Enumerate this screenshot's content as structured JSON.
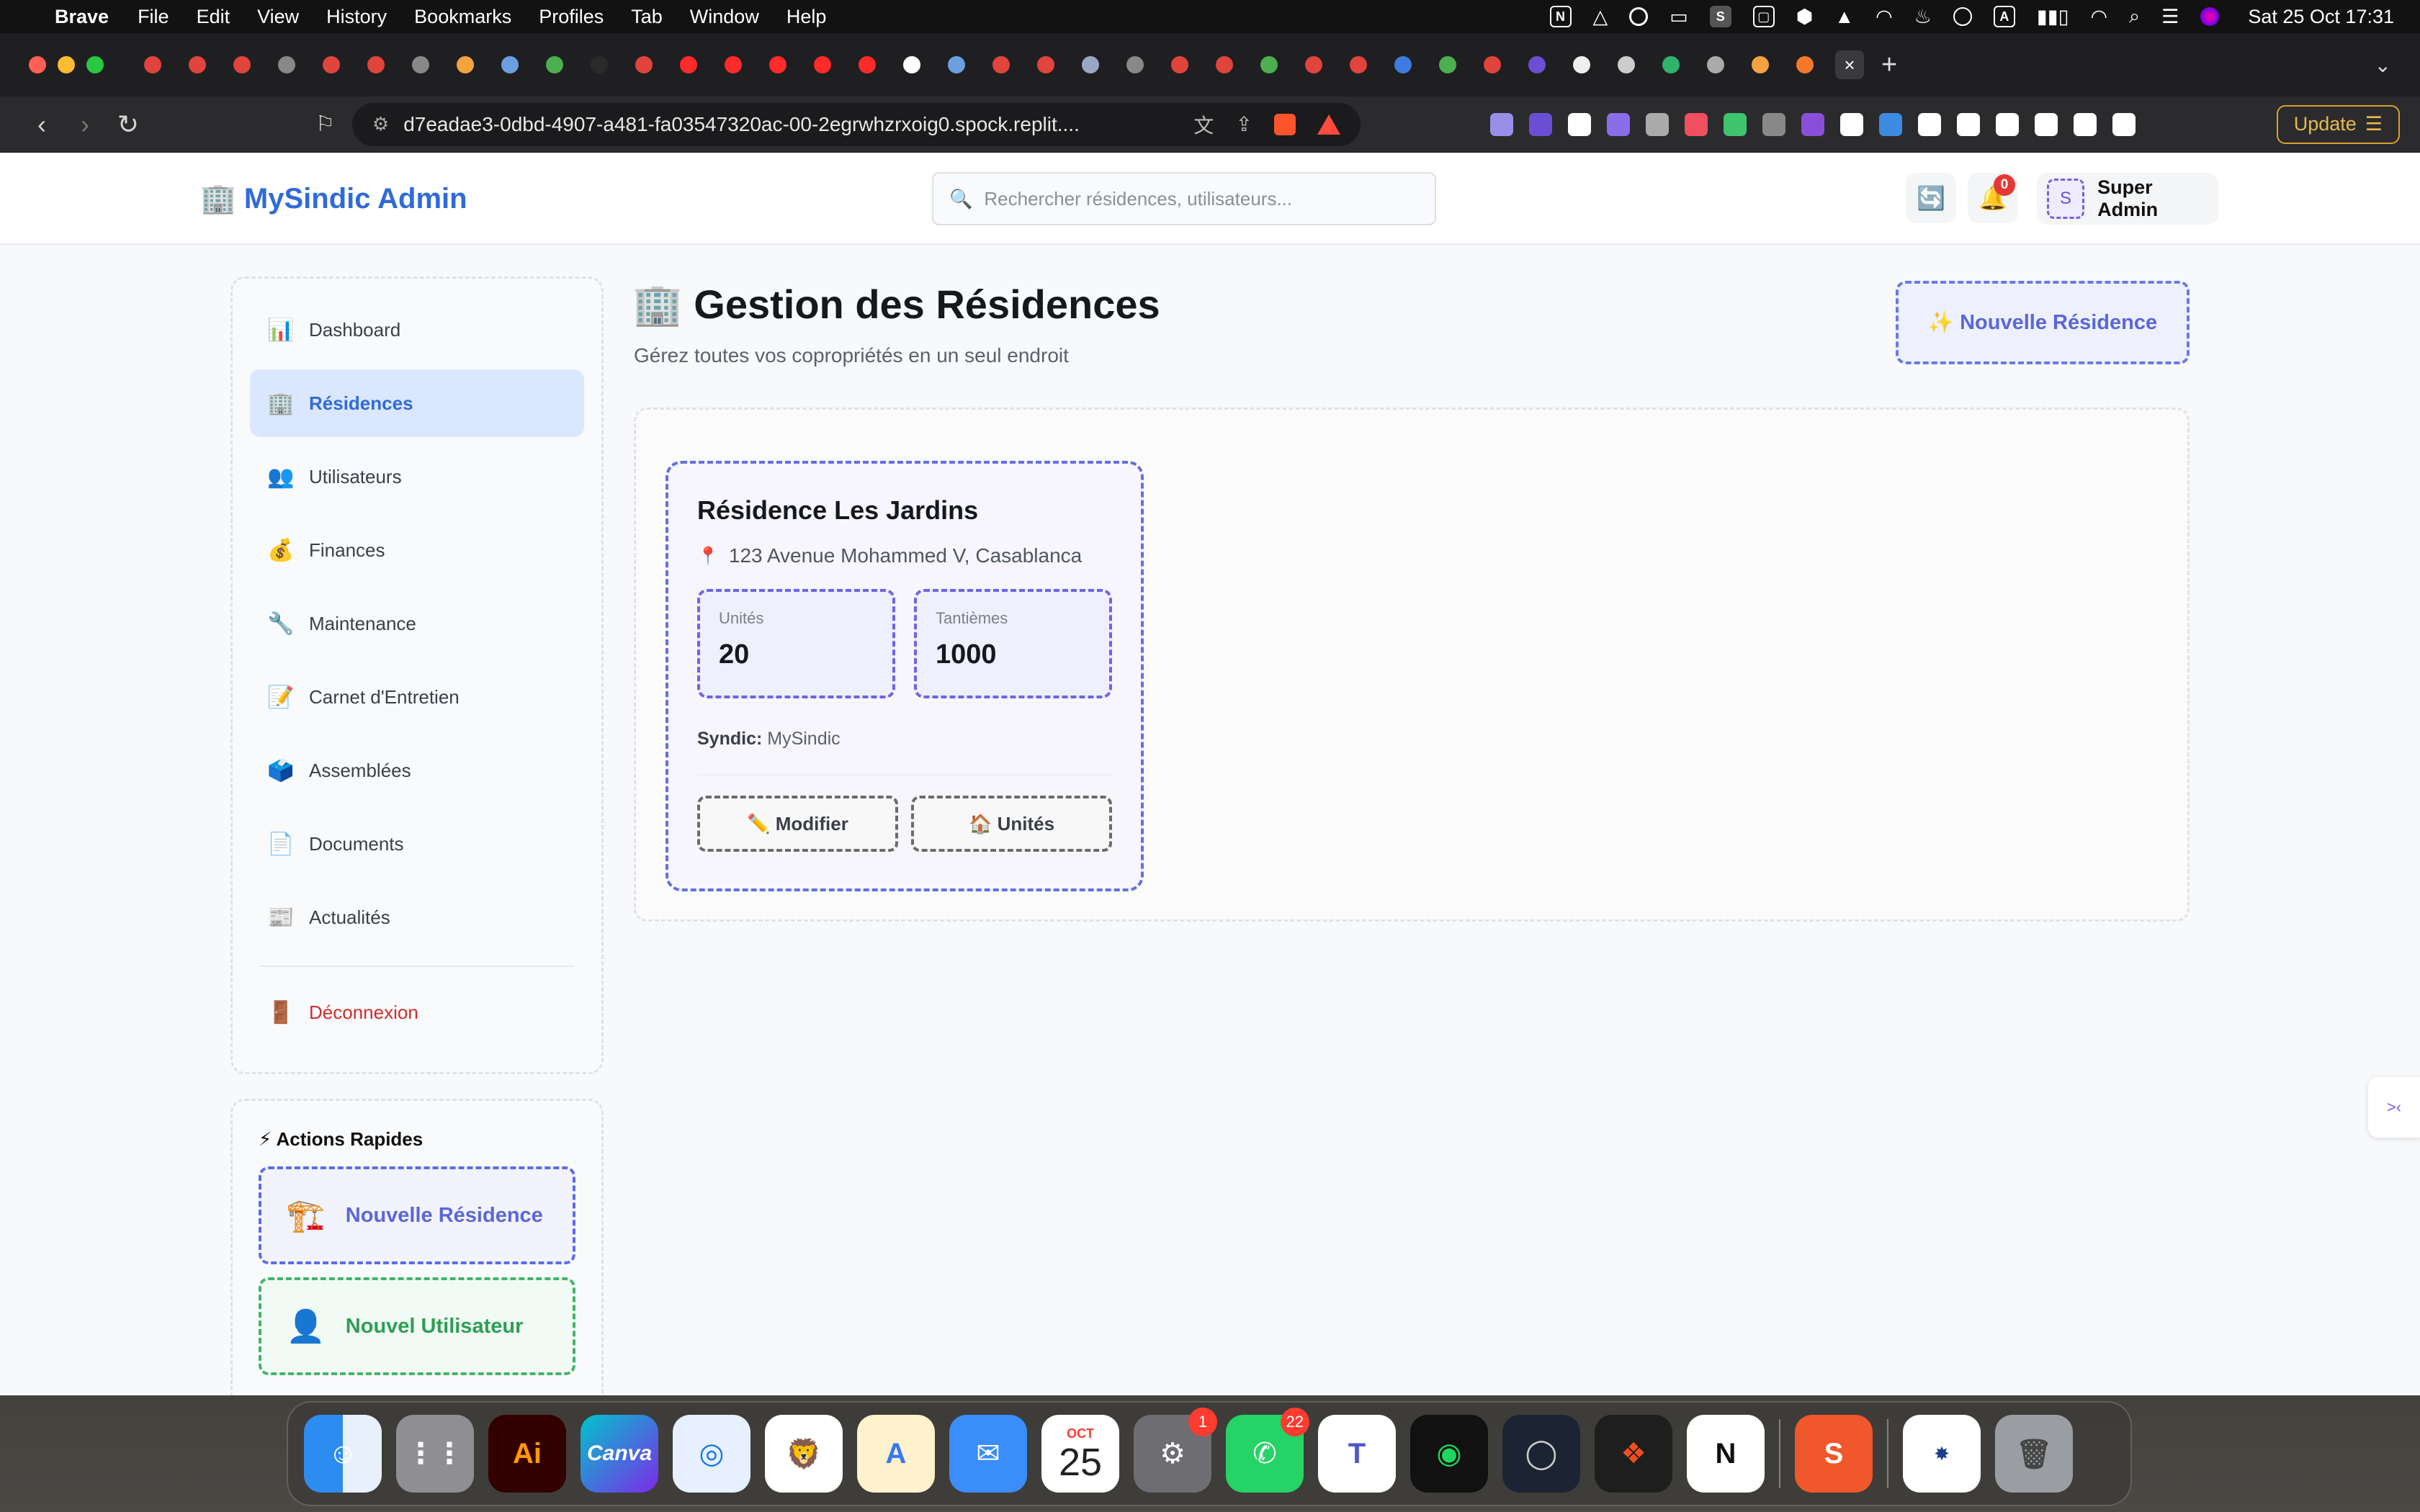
{
  "menubar": {
    "app": "Brave",
    "items": [
      "File",
      "Edit",
      "View",
      "History",
      "Bookmarks",
      "Profiles",
      "Tab",
      "Window",
      "Help"
    ],
    "status_a_icon": "A",
    "clock": "Sat 25 Oct  17:31"
  },
  "browser": {
    "url": "d7eadae3-0dbd-4907-a481-fa03547320ac-00-2egrwhzrxoig0.spock.replit....",
    "update_label": "Update",
    "tab_colors": [
      "#e0443c",
      "#e0443c",
      "#e0443c",
      "#888",
      "#e0443c",
      "#e0443c",
      "#888",
      "#f4a340",
      "#6aa0e0",
      "#4caf50",
      "#2a2a2a",
      "#e0443c",
      "#ff2a2a",
      "#ff2a2a",
      "#ff2a2a",
      "#ff2a2a",
      "#ff2a2a",
      "#ffffff",
      "#6aa0e0",
      "#e0443c",
      "#e0443c",
      "#9aa7c4",
      "#888",
      "#e0443c",
      "#e0443c",
      "#4caf50",
      "#e0443c",
      "#e0443c",
      "#3d7be0",
      "#4caf50",
      "#e0443c",
      "#6a4fd4",
      "#f0f0f0",
      "#cccccc",
      "#2fb36a",
      "#aaaaaa",
      "#f4a340",
      "#f4782b"
    ],
    "ext_colors": [
      "#9a8fe8",
      "#6a4fd4",
      "#ffffff",
      "#8a6de9",
      "#aaaaaa",
      "#ef4f5f",
      "#3ec46d",
      "#888",
      "#8a4fd8",
      "#ffffff",
      "#3d8be0",
      "#ffffff",
      "#ffffff",
      "#ffffff",
      "#ffffff",
      "#ffffff",
      "#ffffff"
    ]
  },
  "header": {
    "brand": "🏢 MySindic Admin",
    "search_placeholder": "Rechercher résidences, utilisateurs...",
    "notif_count": "0",
    "avatar_initial": "S",
    "user_name": "Super Admin"
  },
  "sidebar": {
    "items": [
      {
        "icon": "📊",
        "label": "Dashboard"
      },
      {
        "icon": "🏢",
        "label": "Résidences"
      },
      {
        "icon": "👥",
        "label": "Utilisateurs"
      },
      {
        "icon": "💰",
        "label": "Finances"
      },
      {
        "icon": "🔧",
        "label": "Maintenance"
      },
      {
        "icon": "📝",
        "label": "Carnet d'Entretien"
      },
      {
        "icon": "🗳️",
        "label": "Assemblées"
      },
      {
        "icon": "📄",
        "label": "Documents"
      },
      {
        "icon": "📰",
        "label": "Actualités"
      }
    ],
    "logout": {
      "icon": "🚪",
      "label": "Déconnexion"
    }
  },
  "quick_actions": {
    "title": "⚡ Actions Rapides",
    "items": [
      {
        "icon": "🏗️",
        "label": "Nouvelle Résidence"
      },
      {
        "icon": "👤",
        "label": "Nouvel Utilisateur"
      }
    ]
  },
  "main": {
    "title": "🏢 Gestion des Résidences",
    "subtitle": "Gérez toutes vos copropriétés en un seul endroit",
    "new_button": "✨ Nouvelle Résidence"
  },
  "residence": {
    "name": "Résidence Les Jardins",
    "address": "123 Avenue Mohammed V, Casablanca",
    "units_label": "Unités",
    "units_value": "20",
    "tantiemes_label": "Tantièmes",
    "tantiemes_value": "1000",
    "syndic_label": "Syndic:",
    "syndic_value": "MySindic",
    "edit_label": "✏️ Modifier",
    "units_button": "🏠 Unités"
  },
  "dock": {
    "calendar_month": "OCT",
    "calendar_day": "25",
    "settings_badge": "1",
    "whatsapp_badge": "22"
  }
}
